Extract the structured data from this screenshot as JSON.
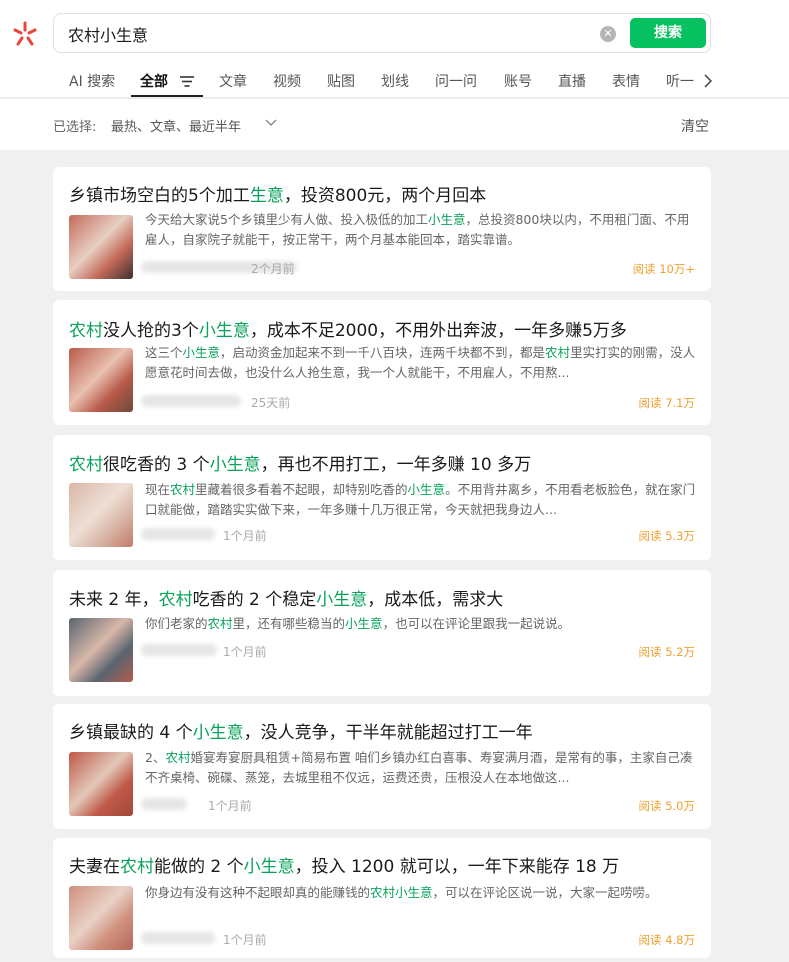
{
  "search": {
    "query": "农村小生意",
    "button_label": "搜索"
  },
  "tabs": [
    {
      "label": "AI 搜索"
    },
    {
      "label": "全部"
    },
    {
      "label": "文章"
    },
    {
      "label": "视频"
    },
    {
      "label": "贴图"
    },
    {
      "label": "划线"
    },
    {
      "label": "问一问"
    },
    {
      "label": "账号"
    },
    {
      "label": "直播"
    },
    {
      "label": "表情"
    },
    {
      "label": "听一"
    }
  ],
  "filters": {
    "label": "已选择:",
    "values": "最热、文章、最近半年",
    "clear_label": "清空"
  },
  "colors": {
    "accent": "#07c160",
    "highlight": "#07a35a",
    "read_count": "#f0a030",
    "brand_red": "#e8453c"
  },
  "icons": {
    "logo": "wechat-search-logo",
    "clear": "clear-circle-icon",
    "filter": "filter-lines-icon",
    "more": "chevron-right-icon",
    "filter_chevron": "chevron-down-icon"
  },
  "results": [
    {
      "title_parts": [
        {
          "t": "乡镇市场空白的5个加工"
        },
        {
          "t": "生意",
          "h": true
        },
        {
          "t": "，投资800元，两个月回本"
        }
      ],
      "summary_parts": [
        {
          "t": "今天给大家说5个乡镇里少有人做、投入极低的加工"
        },
        {
          "t": "小生意",
          "h": true
        },
        {
          "t": "，总投资800块以内，不用租门面、不用雇人，自家院子就能干，按正常干，两个月基本能回本，踏实靠谱。"
        }
      ],
      "time": "2个月前",
      "reads": "阅读 10万+"
    },
    {
      "title_parts": [
        {
          "t": "农村",
          "h": true
        },
        {
          "t": "没人抢的3个"
        },
        {
          "t": "小生意",
          "h": true
        },
        {
          "t": "，成本不足2000，不用外出奔波，一年多赚5万多"
        }
      ],
      "summary_parts": [
        {
          "t": "这三个"
        },
        {
          "t": "小生意",
          "h": true
        },
        {
          "t": "，启动资金加起来不到一千八百块，连两千块都不到，都是"
        },
        {
          "t": "农村",
          "h": true
        },
        {
          "t": "里实打实的刚需，没人愿意花时间去做，也没什么人抢生意，我一个人就能干，不用雇人，不用熬..."
        }
      ],
      "time": "25天前",
      "reads": "阅读 7.1万"
    },
    {
      "title_parts": [
        {
          "t": "农村",
          "h": true
        },
        {
          "t": "很吃香的 3 个"
        },
        {
          "t": "小生意",
          "h": true
        },
        {
          "t": "，再也不用打工，一年多赚 10 多万"
        }
      ],
      "summary_parts": [
        {
          "t": "现在"
        },
        {
          "t": "农村",
          "h": true
        },
        {
          "t": "里藏着很多看着不起眼，却特别吃香的"
        },
        {
          "t": "小生意",
          "h": true
        },
        {
          "t": "。不用背井离乡，不用看老板脸色，就在家门口就能做，踏踏实实做下来，一年多赚十几万很正常，今天就把我身边人..."
        }
      ],
      "time": "1个月前",
      "reads": "阅读 5.3万"
    },
    {
      "title_parts": [
        {
          "t": "未来 2 年，"
        },
        {
          "t": "农村",
          "h": true
        },
        {
          "t": "吃香的 2 个稳定"
        },
        {
          "t": "小生意",
          "h": true
        },
        {
          "t": "，成本低，需求大"
        }
      ],
      "summary_parts": [
        {
          "t": "你们老家的"
        },
        {
          "t": "农村",
          "h": true
        },
        {
          "t": "里，还有哪些稳当的"
        },
        {
          "t": "小生意",
          "h": true
        },
        {
          "t": "，也可以在评论里跟我一起说说。"
        }
      ],
      "time": "1个月前",
      "reads": "阅读 5.2万"
    },
    {
      "title_parts": [
        {
          "t": "乡镇最缺的 4 个"
        },
        {
          "t": "小生意",
          "h": true
        },
        {
          "t": "，没人竞争，干半年就能超过打工一年"
        }
      ],
      "summary_parts": [
        {
          "t": "2、"
        },
        {
          "t": "农村",
          "h": true
        },
        {
          "t": "婚宴寿宴厨具租赁+简易布置 咱们乡镇办红白喜事、寿宴满月酒，是常有的事，主家自己凑不齐桌椅、碗碟、蒸笼，去城里租不仅远，运费还贵，压根没人在本地做这..."
        }
      ],
      "time": "1个月前",
      "reads": "阅读 5.0万"
    },
    {
      "title_parts": [
        {
          "t": "夫妻在"
        },
        {
          "t": "农村",
          "h": true
        },
        {
          "t": "能做的 2 个"
        },
        {
          "t": "小生意",
          "h": true
        },
        {
          "t": "，投入 1200 就可以，一年下来能存 18 万"
        }
      ],
      "summary_parts": [
        {
          "t": "你身边有没有这种不起眼却真的能赚钱的"
        },
        {
          "t": "农村小生意",
          "h": true
        },
        {
          "t": "，可以在评论区说一说，大家一起唠唠。"
        }
      ],
      "time": "1个月前",
      "reads": "阅读 4.8万"
    }
  ]
}
